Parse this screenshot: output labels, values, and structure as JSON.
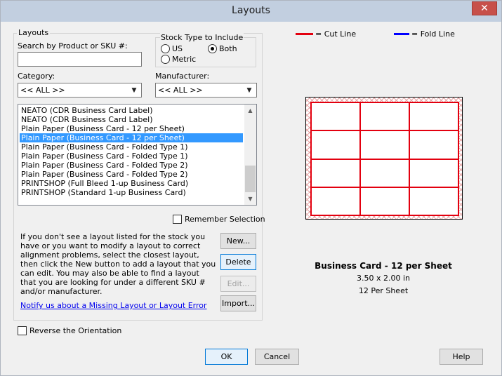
{
  "window": {
    "title": "Layouts",
    "close_label": "✕"
  },
  "layouts_group": {
    "label": "Layouts",
    "search_label": "Search by Product or SKU #:",
    "search_value": "",
    "stock_type": {
      "label": "Stock Type to Include",
      "options": [
        "US",
        "Both",
        "Metric"
      ],
      "selected": "Both"
    },
    "category": {
      "label": "Category:",
      "value": "<< ALL >>"
    },
    "manufacturer": {
      "label": "Manufacturer:",
      "value": "<< ALL >>"
    },
    "list_items": [
      "NEATO (CDR Business Card Label)",
      "NEATO (CDR Business Card Label)",
      "Plain Paper (Business Card - 12 per Sheet)",
      "Plain Paper (Business Card - 12 per Sheet)",
      "Plain Paper (Business Card - Folded Type 1)",
      "Plain Paper (Business Card - Folded Type 1)",
      "Plain Paper (Business Card - Folded Type 2)",
      "Plain Paper (Business Card - Folded Type 2)",
      "PRINTSHOP (Full Bleed 1-up Business Card)",
      "PRINTSHOP (Standard 1-up Business Card)"
    ],
    "selected_index": 3,
    "remember_label": "Remember Selection",
    "remember_checked": false,
    "info_text": "If you don't see a layout listed for the stock you have or you want to modify a layout to correct alignment problems, select the closest layout, then click the New button to add a layout that you can edit.  You may also be able to find a layout that you are looking for under a different SKU # and/or manufacturer.",
    "missing_link": "Notify us about a Missing Layout or Layout Error",
    "buttons": {
      "new": "New...",
      "delete": "Delete",
      "edit": "Edit...",
      "import": "Import..."
    }
  },
  "reverse_label": "Reverse the Orientation",
  "reverse_checked": false,
  "preview": {
    "cut_line_label": "= Cut Line",
    "fold_line_label": "= Fold Line",
    "cut_color": "#e3000f",
    "fold_color": "#0000ff",
    "rows": 4,
    "cols": 3,
    "name": "Business Card - 12 per Sheet",
    "size": "3.50 x 2.00 in",
    "per_sheet": "12 Per Sheet"
  },
  "footer": {
    "ok": "OK",
    "cancel": "Cancel",
    "help": "Help"
  }
}
